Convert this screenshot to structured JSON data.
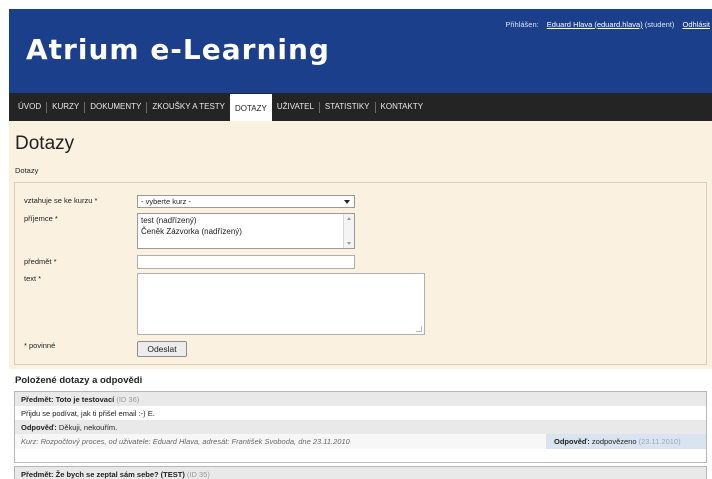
{
  "header": {
    "user_prefix": "Přihlášen:",
    "user_link": "Eduard Hlava (eduard.hlava)",
    "user_role": "(student)",
    "logout": "Odhlásit",
    "logo": "Atrium e-Learning",
    "bg_color": "#1c3f8c"
  },
  "nav": {
    "items": [
      "ÚVOD",
      "KURZY",
      "DOKUMENTY",
      "ZKOUŠKY A TESTY",
      "DOTAZY",
      "UŽIVATEL",
      "STATISTIKY",
      "KONTAKTY"
    ],
    "active": "DOTAZY"
  },
  "page": {
    "title": "Dotazy",
    "breadcrumb": "Dotazy"
  },
  "form": {
    "course_label": "vztahuje se ke kurzu *",
    "course_value": "- vyberte kurz -",
    "recipient_label": "příjemce *",
    "recipients": [
      "test (nadřízený)",
      "Čeněk Zázvorka (nadřízený)"
    ],
    "subject_label": "předmět *",
    "text_label": "text *",
    "required_note": "* povinné",
    "submit": "Odeslat"
  },
  "questions": {
    "title": "Položené dotazy a odpovědi",
    "items": [
      {
        "subject_prefix": "Předmět:",
        "subject": "Toto je testovací",
        "id": "(ID 36)",
        "body": "Přijdu se podívat, jak ti přišel email :-) E.",
        "answer_prefix": "Odpověď:",
        "answer": "Děkuji, nekouřím.",
        "meta": "Kurz: Rozpočtový proces, od uživatele: Eduard Hlava, adresát: František Svoboda, dne 23.11.2010",
        "status_prefix": "Odpověď:",
        "status": "zodpovězeno",
        "status_date": "(23.11.2010)"
      },
      {
        "subject_prefix": "Předmět:",
        "subject": "Že bych se zeptal sám sebe? (TEST)",
        "id": "(ID 35)"
      }
    ]
  }
}
